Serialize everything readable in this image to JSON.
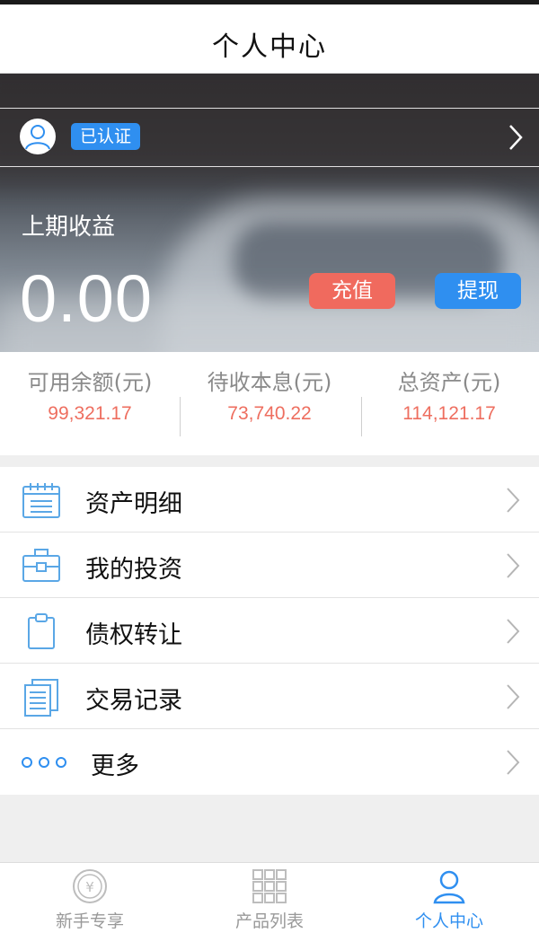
{
  "header": {
    "title": "个人中心"
  },
  "profile": {
    "verified_badge": "已认证"
  },
  "income": {
    "label": "上期收益",
    "value": "0.00"
  },
  "actions": {
    "recharge_label": "充值",
    "withdraw_label": "提现"
  },
  "stats": [
    {
      "label": "可用余额(元)",
      "value": "99,321.17"
    },
    {
      "label": "待收本息(元)",
      "value": "73,740.22"
    },
    {
      "label": "总资产(元)",
      "value": "114,121.17"
    }
  ],
  "menu": [
    {
      "label": "资产明细",
      "icon": "calendar-list-icon"
    },
    {
      "label": "我的投资",
      "icon": "briefcase-icon"
    },
    {
      "label": "债权转让",
      "icon": "clipboard-icon"
    },
    {
      "label": "交易记录",
      "icon": "documents-icon"
    },
    {
      "label": "更多",
      "icon": "more-dots-icon"
    }
  ],
  "tabs": [
    {
      "label": "新手专享",
      "icon": "yuan-coin-icon",
      "active": false
    },
    {
      "label": "产品列表",
      "icon": "grid-icon",
      "active": false
    },
    {
      "label": "个人中心",
      "icon": "user-icon",
      "active": true
    }
  ],
  "colors": {
    "accent_blue": "#2f8ff0",
    "accent_red": "#f06a5e",
    "value_red": "#ee6e5f"
  }
}
